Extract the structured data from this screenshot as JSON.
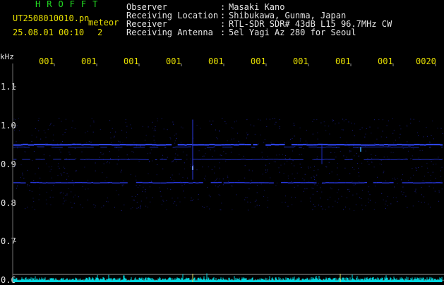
{
  "header": {
    "brand": "HROFFT",
    "filename": "UT2508010010.pn",
    "meteor_label": "meteor",
    "datetime": "25.08.01 00:10",
    "count": "2"
  },
  "info": [
    {
      "label": "Observer",
      "value": "Masaki Kano"
    },
    {
      "label": "Receiving Location",
      "value": "Shibukawa, Gunma, Japan"
    },
    {
      "label": "Receiver",
      "value": "RTL-SDR SDR# 43dB L15 96.7MHz CW"
    },
    {
      "label": "Receiving Antenna",
      "value": "5el Yagi Az 280 for Seoul"
    }
  ],
  "separator": ":",
  "chart_data": {
    "type": "heatmap",
    "ylabel": "kHz",
    "x_tick_labels": [
      "001",
      "001",
      "001",
      "001",
      "001",
      "001",
      "001",
      "001",
      "001",
      "0020"
    ],
    "y_tick_labels": [
      "1.1",
      "1.0",
      "0.9",
      "0.8",
      "0.7",
      "0.6"
    ],
    "y_ticks": [
      1.1,
      1.0,
      0.9,
      0.8,
      0.7,
      0.6
    ],
    "ylim": [
      0.595,
      1.16
    ],
    "colors": {
      "background": "#000000",
      "trace": "#2c3cff",
      "noise": "#00e8e8",
      "grid": "#909090",
      "tick_text": "#e8e000"
    }
  }
}
